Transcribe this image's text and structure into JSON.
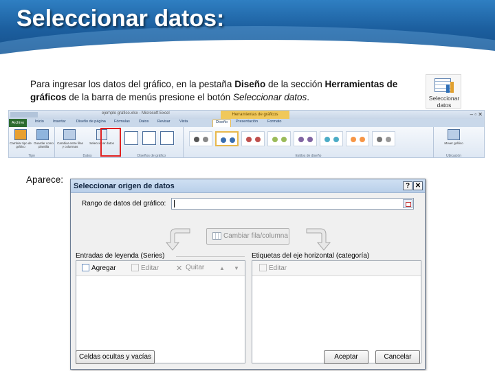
{
  "slide": {
    "title": "Seleccionar datos:",
    "para_1": "Para ingresar los datos del gráfico, en  la pestaña ",
    "para_b1": "Diseño",
    "para_2": " de la sección ",
    "para_b2": "Herramientas de gráficos",
    "para_3": " de la barra de menús presione el botón ",
    "para_i": "Seleccionar datos",
    "para_4": ".",
    "aparece": "Aparece:",
    "big_icon_label": "Seleccionar datos"
  },
  "ribbon": {
    "window_title": "ejemplo gráfico.xlsx - Microsoft Excel",
    "context_tab": "Herramientas de gráficos",
    "tabs": [
      "Archivo",
      "Inicio",
      "Insertar",
      "Diseño de página",
      "Fórmulas",
      "Datos",
      "Revisar",
      "Vista",
      "Diseño",
      "Presentación",
      "Formato"
    ],
    "groups": {
      "tipo": "Tipo",
      "datos": "Datos",
      "disenos": "Diseños de gráfico",
      "estilos": "Estilos de diseño",
      "ubicacion": "Ubicación"
    },
    "buttons": {
      "cambiar_tipo": "Cambiar tipo de gráfico",
      "guardar": "Guardar como plantilla",
      "cambiar_fila": "Cambiar entre filas y columnas",
      "seleccionar": "Seleccionar datos",
      "mover": "Mover gráfico"
    }
  },
  "dialog": {
    "title": "Seleccionar origen de datos",
    "help": "?",
    "close": "✕",
    "range_label_pre": "Rango de datos del ",
    "range_label_u": "g",
    "range_label_post": "ráfico:",
    "range_value": "",
    "switch_label": "Cambiar fila/columna",
    "series_label": "Entradas de leyenda (Series)",
    "category_label": "Etiquetas del eje horizontal (categoría)",
    "series_buttons": {
      "add": "Agregar",
      "edit": "Editar",
      "remove": "Quitar",
      "up": "▲",
      "down": "▼"
    },
    "category_buttons": {
      "edit": "Editar"
    },
    "hidden_cells": "Celdas ocultas y vacías",
    "ok": "Aceptar",
    "cancel": "Cancelar"
  },
  "colors": {
    "header_blue": "#1c5f9f",
    "highlight_red": "#e02020",
    "ok_green": "#2c6b2f"
  }
}
